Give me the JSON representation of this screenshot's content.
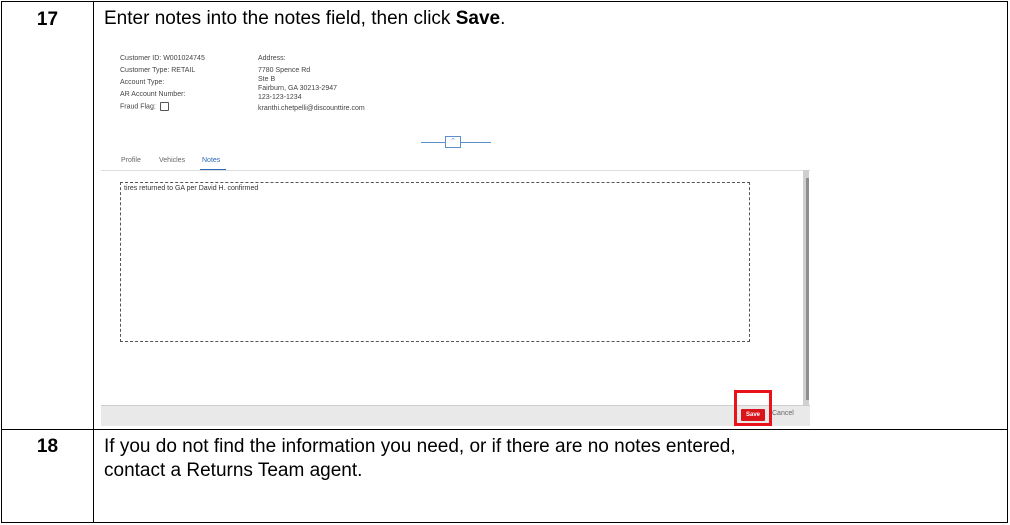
{
  "steps": [
    {
      "number": "17",
      "text_before": "Enter notes into the notes field, then click ",
      "text_bold": "Save",
      "text_after": "."
    },
    {
      "number": "18",
      "text_line1": "If you do not find the information you need, or if there are no notes entered,",
      "text_line2": "contact a Returns Team agent."
    }
  ],
  "screenshot": {
    "customer_id_label": "Customer ID:",
    "customer_id": "W001024745",
    "customer_type_label": "Customer Type:",
    "customer_type": "RETAIL",
    "account_type_label": "Account Type:",
    "ar_account_label": "AR Account Number:",
    "fraud_flag_label": "Fraud Flag:",
    "address_label": "Address:",
    "address_lines": [
      "7780 Spence Rd",
      "Ste B",
      "Fairburn, GA 30213-2947",
      "123-123-1234",
      "kranthi.chetpelli@discounttire.com"
    ],
    "collapse_glyph": "⌃",
    "tabs": [
      "Profile",
      "Vehicles",
      "Notes"
    ],
    "active_tab": "Notes",
    "notes_value": "tires returned to GA per David H. confirmed",
    "save_label": "Save",
    "cancel_label": "Cancel"
  }
}
